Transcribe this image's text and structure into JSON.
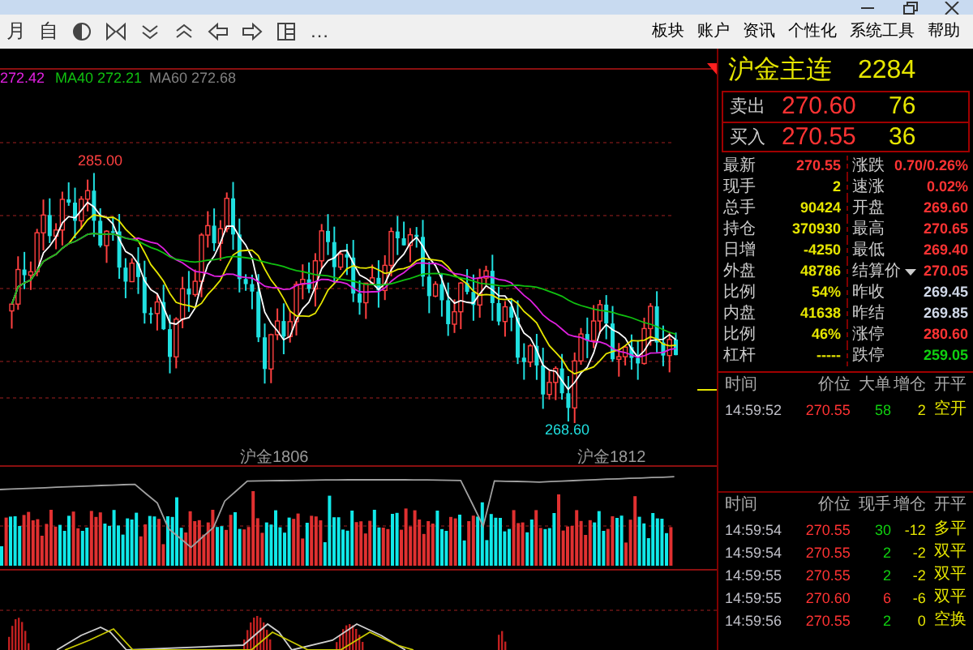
{
  "toolbar": {
    "labels": [
      "月",
      "自"
    ],
    "more": "…"
  },
  "menu": [
    "板块",
    "账户",
    "资讯",
    "个性化",
    "系统工具",
    "帮助"
  ],
  "chart": {
    "ma_legend": [
      {
        "label": "272.42",
        "color": "#e020e0"
      },
      {
        "label": "MA40 272.21",
        "color": "#10c010"
      },
      {
        "label": "MA60 272.68",
        "color": "#808080"
      }
    ],
    "high_label": "285.00",
    "low_label": "268.60",
    "contract_labels": [
      "沪金1806",
      "沪金1812"
    ]
  },
  "quote": {
    "name": "沪金主连",
    "code": "2284",
    "ask": {
      "label": "卖出",
      "price": "270.60",
      "volume": "76"
    },
    "bid": {
      "label": "买入",
      "price": "270.55",
      "volume": "36"
    },
    "stats": [
      {
        "left": {
          "label": "最新",
          "value": "270.55",
          "color": "#ff3333"
        },
        "right": {
          "label": "涨跌",
          "value": "0.70/0.26%",
          "color": "#ff3333",
          "dropdown": false
        }
      },
      {
        "left": {
          "label": "现手",
          "value": "2",
          "color": "#e6e600"
        },
        "right": {
          "label": "速涨",
          "value": "0.02%",
          "color": "#ff3333",
          "dropdown": false
        }
      },
      {
        "left": {
          "label": "总手",
          "value": "90424",
          "color": "#e6e600"
        },
        "right": {
          "label": "开盘",
          "value": "269.60",
          "color": "#ff3333",
          "dropdown": false
        }
      },
      {
        "left": {
          "label": "持仓",
          "value": "370930",
          "color": "#e6e600"
        },
        "right": {
          "label": "最高",
          "value": "270.65",
          "color": "#ff3333",
          "dropdown": false
        }
      },
      {
        "left": {
          "label": "日增",
          "value": "-4250",
          "color": "#e6e600"
        },
        "right": {
          "label": "最低",
          "value": "269.40",
          "color": "#ff3333",
          "dropdown": false
        }
      },
      {
        "left": {
          "label": "外盘",
          "value": "48786",
          "color": "#e6e600"
        },
        "right": {
          "label": "结算价",
          "value": "270.05",
          "color": "#ff3333",
          "dropdown": true
        }
      },
      {
        "left": {
          "label": "比例",
          "value": "54%",
          "color": "#e6e600"
        },
        "right": {
          "label": "昨收",
          "value": "269.45",
          "color": "#d0d8e8",
          "dropdown": false
        }
      },
      {
        "left": {
          "label": "内盘",
          "value": "41638",
          "color": "#e6e600"
        },
        "right": {
          "label": "昨结",
          "value": "269.85",
          "color": "#d0d8e8",
          "dropdown": false
        }
      },
      {
        "left": {
          "label": "比例",
          "value": "46%",
          "color": "#e6e600"
        },
        "right": {
          "label": "涨停",
          "value": "280.60",
          "color": "#ff3333",
          "dropdown": false
        }
      },
      {
        "left": {
          "label": "杠杆",
          "value": "-----",
          "color": "#e6e600"
        },
        "right": {
          "label": "跌停",
          "value": "259.05",
          "color": "#10d010",
          "dropdown": false
        }
      }
    ]
  },
  "big_orders": {
    "columns": [
      "时间",
      "价位",
      "大单",
      "增仓",
      "开平"
    ],
    "rows": [
      {
        "time": "14:59:52",
        "price": "270.55",
        "volume": {
          "value": "58",
          "color": "#10d010"
        },
        "change": "2",
        "type": "空开"
      }
    ]
  },
  "ticks": {
    "columns": [
      "时间",
      "价位",
      "现手",
      "增仓",
      "开平"
    ],
    "rows": [
      {
        "time": "14:59:54",
        "price": "270.55",
        "volume": {
          "value": "30",
          "color": "#10d010"
        },
        "change": "-12",
        "type": "多平"
      },
      {
        "time": "14:59:54",
        "price": "270.55",
        "volume": {
          "value": "2",
          "color": "#10d010"
        },
        "change": "-2",
        "type": "双平"
      },
      {
        "time": "14:59:55",
        "price": "270.55",
        "volume": {
          "value": "2",
          "color": "#10d010"
        },
        "change": "-2",
        "type": "双平"
      },
      {
        "time": "14:59:55",
        "price": "270.60",
        "volume": {
          "value": "6",
          "color": "#ff3333"
        },
        "change": "-6",
        "type": "双平"
      },
      {
        "time": "14:59:56",
        "price": "270.55",
        "volume": {
          "value": "2",
          "color": "#10d010"
        },
        "change": "0",
        "type": "空换"
      }
    ]
  }
}
